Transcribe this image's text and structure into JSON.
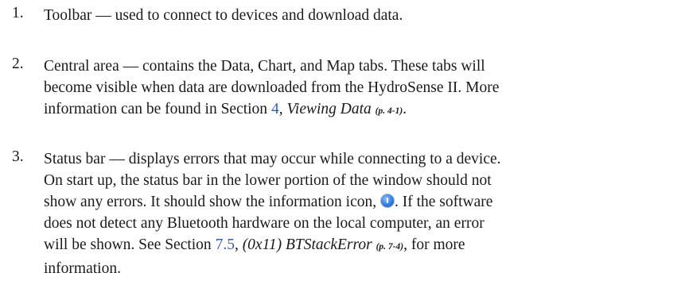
{
  "items": [
    {
      "number": "1.",
      "lines": [
        "Toolbar — used to connect to devices and download data."
      ]
    },
    {
      "number": "2.",
      "lines": [
        "Central area — contains the Data, Chart, and Map tabs. These tabs will",
        "become visible when data are downloaded from the HydroSense II. More"
      ],
      "line3_pre": "information can be found in Section ",
      "link_section": "4",
      "line3_mid": ", ",
      "link_title": "Viewing Data",
      "page_ref": "(p. 4-1)",
      "line3_end": "."
    },
    {
      "number": "3.",
      "lines": [
        "Status bar — displays errors that may occur while connecting to a device.",
        "On start up, the status bar in the lower portion of the window should not"
      ],
      "line3_pre": "show any errors. It should show the information icon, ",
      "line3_post": ". If the software",
      "line4": "does not detect any Bluetooth hardware on the local computer, an error",
      "line5_pre": "will be shown. See Section ",
      "link_section": "7.5",
      "line5_mid": ", ",
      "link_title": "(0x11) BTStackError",
      "page_ref": "(p. 7-4)",
      "line5_post": ", for more",
      "line6": "information.",
      "icon": "information-icon"
    }
  ]
}
